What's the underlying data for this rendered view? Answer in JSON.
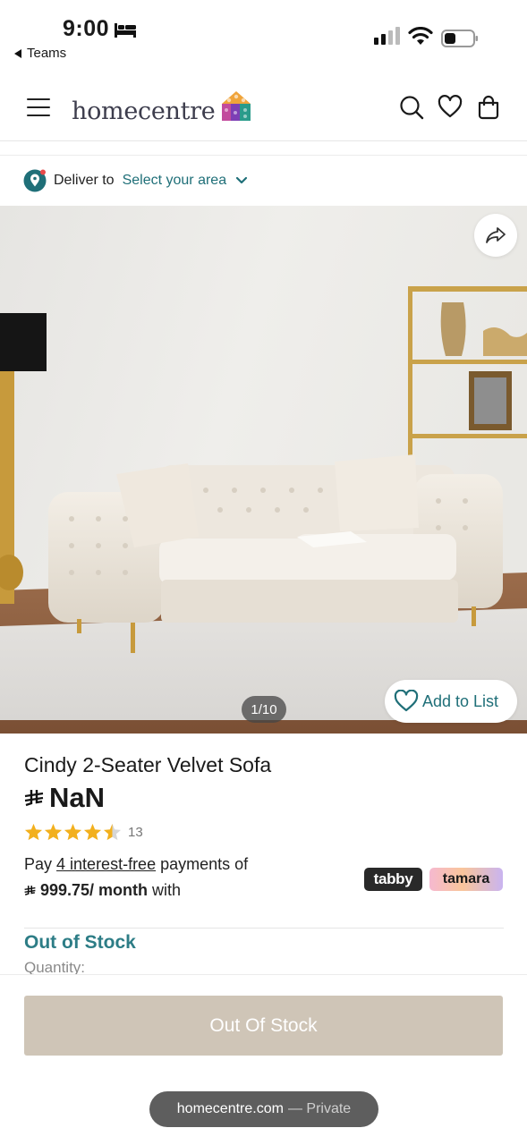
{
  "status_bar": {
    "time": "9:00",
    "back_app": "Teams",
    "sleep_icon": "bed-icon",
    "signal_icon": "cellular-signal-icon",
    "wifi_icon": "wifi-icon",
    "battery_icon": "battery-icon"
  },
  "header": {
    "menu_icon": "hamburger-menu-icon",
    "logo_text": "homecentre",
    "logo_icon": "homecentre-logo-mark",
    "search_icon": "search-icon",
    "wishlist_icon": "heart-icon",
    "cart_icon": "shopping-bag-icon"
  },
  "deliver": {
    "icon": "location-pin-icon",
    "label": "Deliver to",
    "area": "Select your area",
    "chevron_icon": "chevron-down-icon"
  },
  "gallery": {
    "share_icon": "share-icon",
    "counter": "1/10",
    "add_to_list_label": "Add to List",
    "add_to_list_icon": "heart-outline-icon"
  },
  "product": {
    "title": "Cindy 2-Seater Velvet Sofa",
    "currency_icon": "saudi-riyal-icon",
    "price": "NaN",
    "rating": 4.5,
    "rating_max": 5,
    "rating_count": "13",
    "pay_prefix": "Pay ",
    "pay_link": "4 interest-free",
    "pay_suffix": " payments of",
    "monthly_amount": "999.75/ month",
    "monthly_suffix": "with",
    "tabby_label": "tabby",
    "tamara_label": "tamara",
    "stock_status": "Out of Stock",
    "quantity_label": "Quantity:"
  },
  "cta": {
    "button_label": "Out Of Stock"
  },
  "browser": {
    "domain": "homecentre.com",
    "mode": "— Private"
  },
  "colors": {
    "accent": "#1f6f78",
    "stock_text": "#2d7d86",
    "cta_disabled": "#cfc5b7",
    "star": "#f2b01e"
  }
}
